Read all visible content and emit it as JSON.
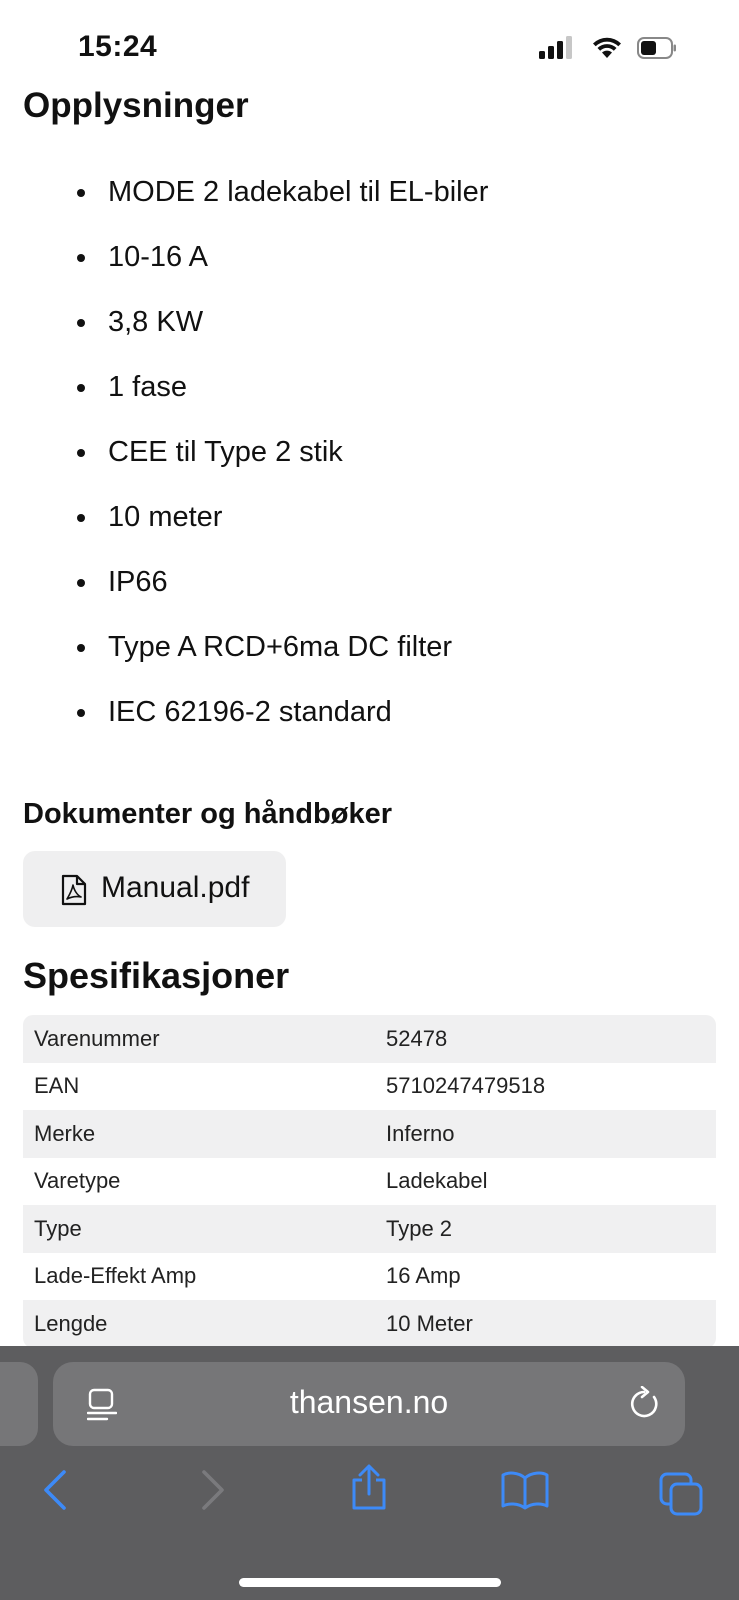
{
  "status_bar": {
    "time": "15:24"
  },
  "info": {
    "heading": "Opplysninger",
    "bullets": [
      "MODE 2 ladekabel til EL-biler",
      "10-16 A",
      "3,8 KW",
      "1 fase",
      "CEE til Type 2 stik",
      "10 meter",
      "IP66",
      "Type A RCD+6ma DC filter",
      "IEC 62196-2 standard"
    ]
  },
  "documents": {
    "heading": "Dokumenter og håndbøker",
    "manual_label": "Manual.pdf"
  },
  "specs": {
    "heading": "Spesifikasjoner",
    "rows": [
      {
        "label": "Varenummer",
        "value": "52478"
      },
      {
        "label": "EAN",
        "value": "5710247479518"
      },
      {
        "label": "Merke",
        "value": "Inferno"
      },
      {
        "label": "Varetype",
        "value": "Ladekabel"
      },
      {
        "label": "Type",
        "value": "Type 2"
      },
      {
        "label": "Lade-Effekt Amp",
        "value": "16 Amp"
      },
      {
        "label": "Lengde",
        "value": "10 Meter"
      }
    ]
  },
  "browser": {
    "url": "thansen.no",
    "accent_color": "#3d8af7"
  }
}
